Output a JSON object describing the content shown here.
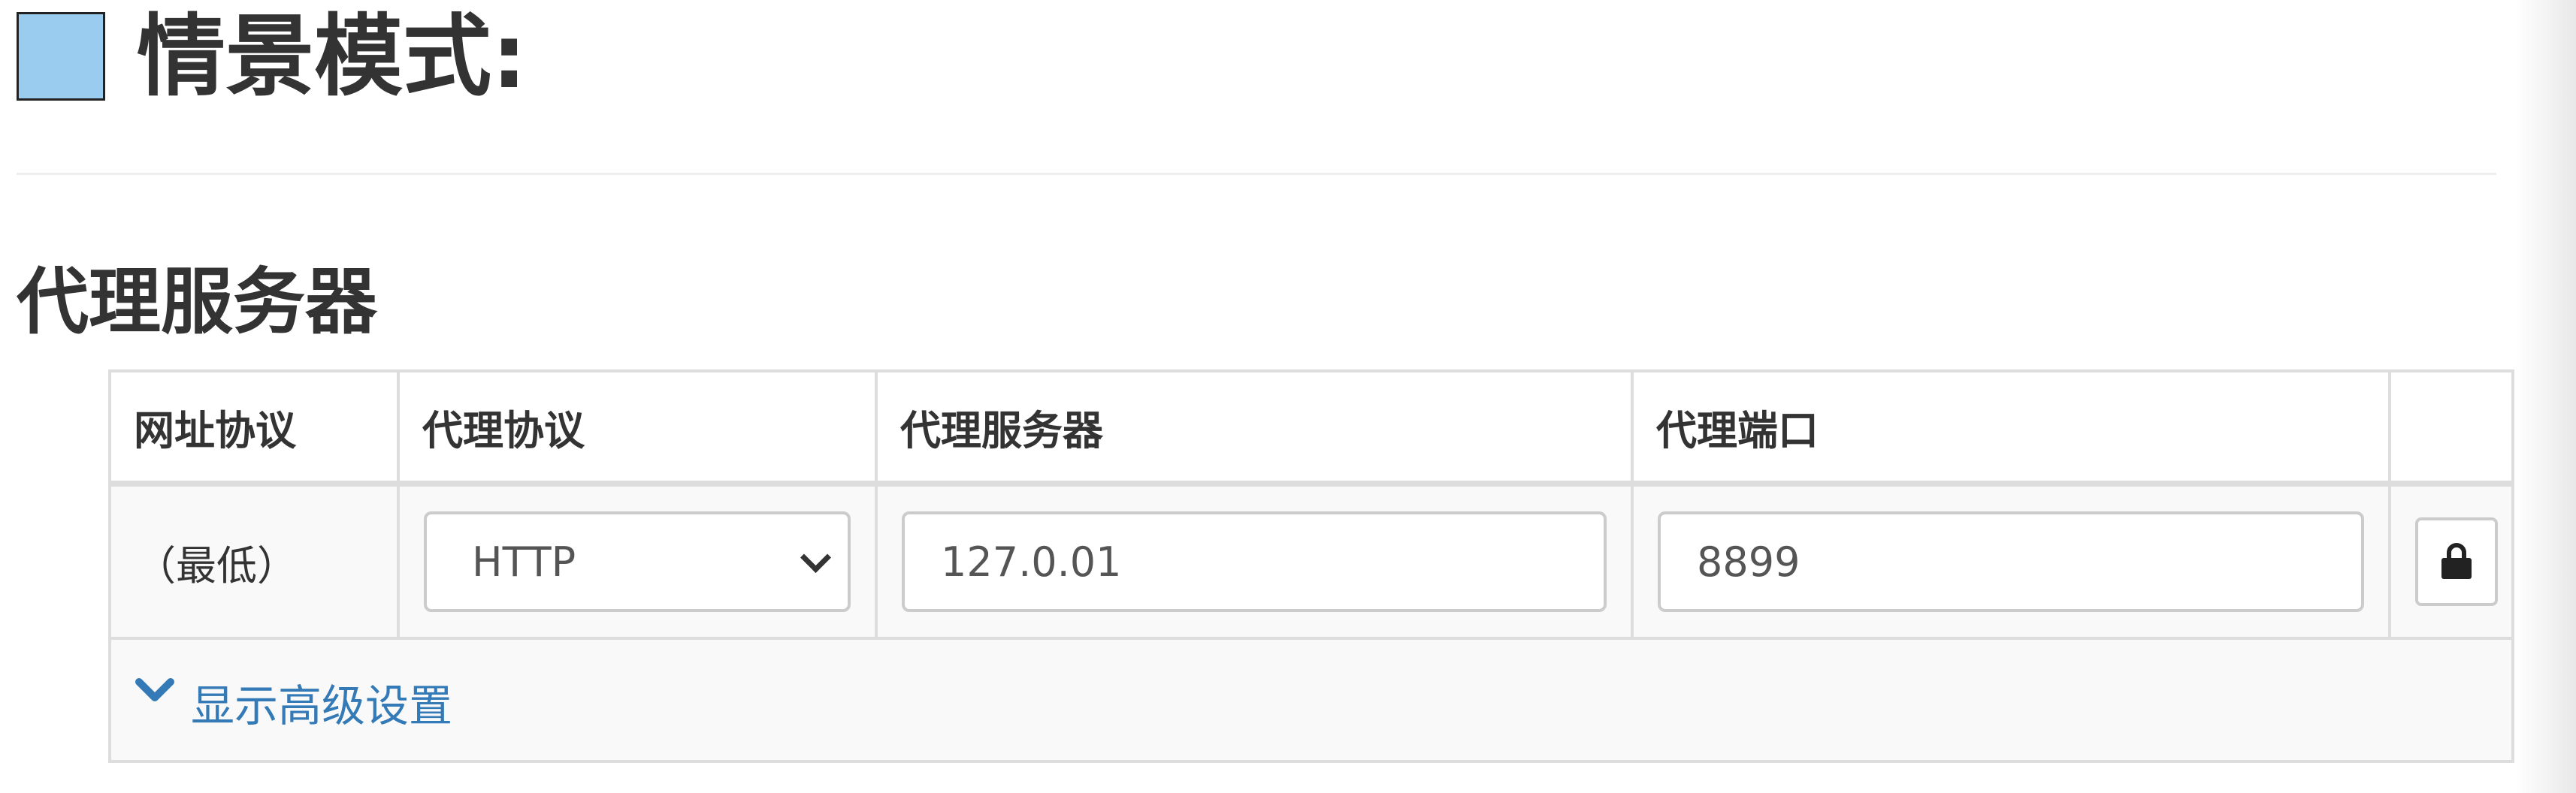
{
  "header": {
    "title": "情景模式:",
    "swatch_color": "#99ccee"
  },
  "section": {
    "title": "代理服务器"
  },
  "table": {
    "columns": [
      "网址协议",
      "代理协议",
      "代理服务器",
      "代理端口",
      ""
    ],
    "rows": [
      {
        "pattern": "（最低）",
        "protocol": "HTTP",
        "server": "127.0.01",
        "port": "8899",
        "action_icon": "lock-icon"
      }
    ]
  },
  "advanced": {
    "label": "显示高级设置",
    "icon": "chevron-down-icon",
    "link_color": "#337ab7"
  }
}
